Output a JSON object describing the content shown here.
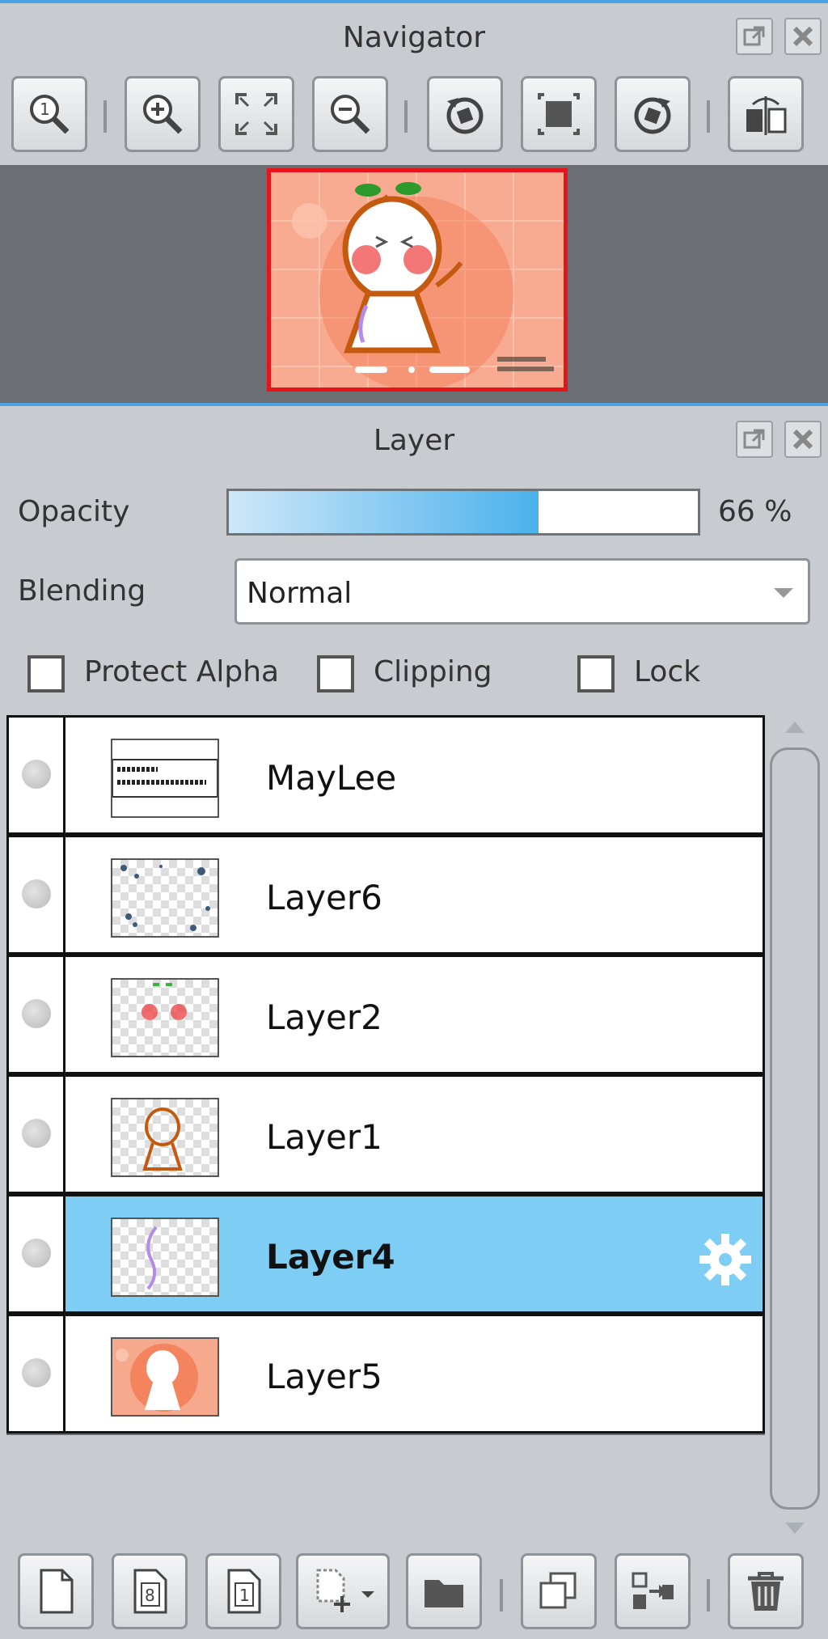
{
  "navigator": {
    "title": "Navigator",
    "toolbar": [
      "zoom-actual-icon",
      "zoom-in-icon",
      "fit-window-icon",
      "zoom-out-icon",
      "rotate-left-icon",
      "reset-rotation-icon",
      "rotate-right-icon",
      "flip-horizontal-icon"
    ]
  },
  "layer_panel": {
    "title": "Layer",
    "opacity_label": "Opacity",
    "opacity_value": "66 %",
    "opacity_fraction": 0.66,
    "blending_label": "Blending",
    "blending_value": "Normal",
    "protect_alpha_label": "Protect Alpha",
    "clipping_label": "Clipping",
    "lock_label": "Lock",
    "layers": [
      {
        "name": "MayLee",
        "selected": false
      },
      {
        "name": "Layer6",
        "selected": false
      },
      {
        "name": "Layer2",
        "selected": false
      },
      {
        "name": "Layer1",
        "selected": false
      },
      {
        "name": "Layer4",
        "selected": true
      },
      {
        "name": "Layer5",
        "selected": false
      }
    ],
    "bottom_toolbar": [
      "new-layer-icon",
      "new-8bit-layer-icon",
      "new-1bit-layer-icon",
      "add-layer-menu-icon",
      "new-folder-icon",
      "duplicate-layer-icon",
      "merge-down-icon",
      "delete-layer-icon"
    ]
  },
  "colors": {
    "accent": "#4aa3df",
    "selected_row": "#7ecdf4",
    "thumb_border": "#e8141a"
  }
}
